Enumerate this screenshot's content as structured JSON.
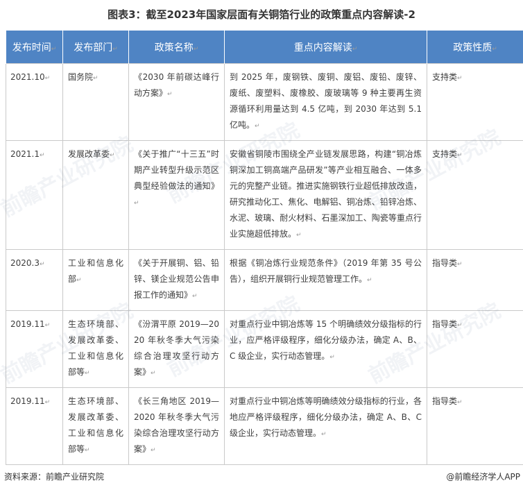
{
  "title": "图表3：截至2023年国家层面有关铜箔行业的政策重点内容解读-2",
  "colors": {
    "header_bg": "#4f84c4",
    "header_text": "#ffffff",
    "border": "#c9c9c9"
  },
  "table": {
    "headers": [
      "发布时间",
      "发布部门",
      "政策名称",
      "重点内容解读",
      "政策性质"
    ],
    "rows": [
      {
        "date": "2021.10",
        "dept": "国务院",
        "name": "《2030 年前碳达峰行动方案》",
        "content": "到 2025 年，废钢铁、废铜、废铝、废铅、废锌、废纸、废塑料、废橡胶、废玻璃等 9 种主要再生资源循环利用量达到 4.5 亿吨，到 2030 年达到 5.1 亿吨。",
        "type": "支持类"
      },
      {
        "date": "2021.1",
        "dept": "发展改革委",
        "name": "《关于推广“十三五”时期产业转型升级示范区典型经验做法的通知》",
        "content": "安徽省铜陵市围绕全产业链发展思路，构建“铜冶炼铜深加工铜高端产品研发”等产业相互融合、一体多元的完整产业链。推进实施钢铁行业超低排放改造，研究推动化工、焦化、电解铝、铜冶炼、铅锌冶炼、水泥、玻璃、耐火材料、石墨深加工、陶瓷等重点行业实施超低排放。",
        "type": "支持类"
      },
      {
        "date": "2020.3",
        "dept": "工业和信息化部",
        "name": "《关于开展铜、铝、铅锌、镁企业规范公告申报工作的通知》",
        "content": "根据《铜冶炼行业规范条件》（2019 年第 35 号公告），组织开展铜行业规范管理工作。",
        "type": "指导类"
      },
      {
        "date": "2019.11",
        "dept": "生态环境部、发展改革委、工业和信息化部等",
        "name": "《汾渭平原 2019—2020 年秋冬季大气污染综合治理攻坚行动方案》",
        "content": "对重点行业中铜冶炼等 15 个明确绩效分级指标的行业，应严格评级程序，细化分级办法，确定 A、B、C 级企业，实行动态管理。",
        "type": "指导类"
      },
      {
        "date": "2019.11",
        "dept": "生态环境部、发展改革委、工业和信息化部等",
        "name": "《长三角地区 2019—2020 年秋冬季大气污染综合治理攻坚行动方案》",
        "content": "对重点行业中铜冶炼等明确绩效分级指标的行业，各地应严格评级程序，细化分级办法，确定 A、B、C 级企业，实行动态管理。",
        "type": "指导类"
      }
    ]
  },
  "watermark": "前瞻产业研究院",
  "footer": {
    "source": "资料来源：前瞻产业研究院",
    "credit": "@前瞻经济学人APP"
  }
}
